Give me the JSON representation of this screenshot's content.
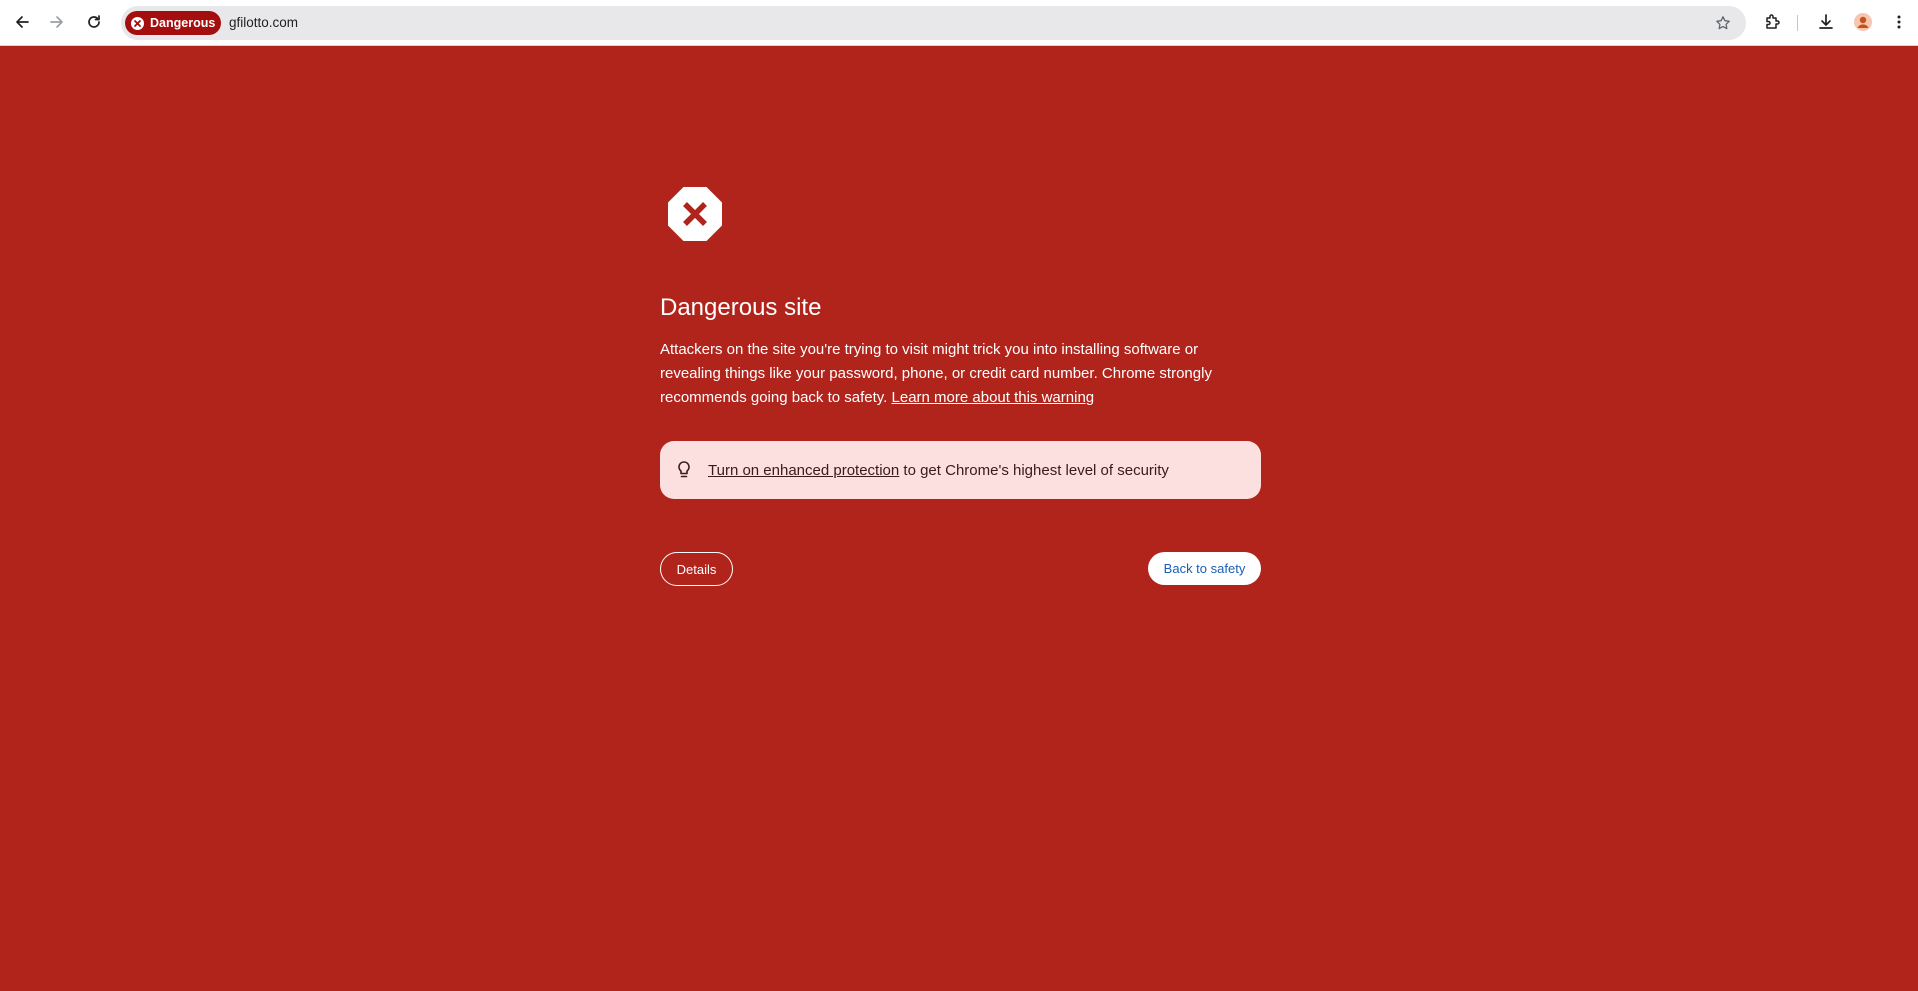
{
  "browser": {
    "security_chip_label": "Dangerous",
    "url": "gfilotto.com"
  },
  "icons": {
    "back": "arrow-left-icon",
    "forward": "arrow-right-icon",
    "reload": "reload-icon",
    "bookmark": "star-icon",
    "extensions": "puzzle-icon",
    "downloads": "download-icon",
    "profile": "avatar-icon",
    "menu": "kebab-menu-icon",
    "warning": "stop-sign-icon",
    "tip": "lightbulb-icon"
  },
  "interstitial": {
    "title": "Dangerous site",
    "body": "Attackers on the site you're trying to visit might trick you into installing software or revealing things like your password, phone, or credit card number. Chrome strongly recommends going back to safety.",
    "learn_more_link": "Learn more about this warning",
    "protection_link": "Turn on enhanced protection",
    "protection_text": " to get Chrome's highest level of security",
    "details_button": "Details",
    "back_button": "Back to safety"
  },
  "colors": {
    "background": "#b1241c",
    "chip": "#a50e0e",
    "protection_box": "#fbe0df",
    "back_button_text": "#1a5fb4"
  }
}
